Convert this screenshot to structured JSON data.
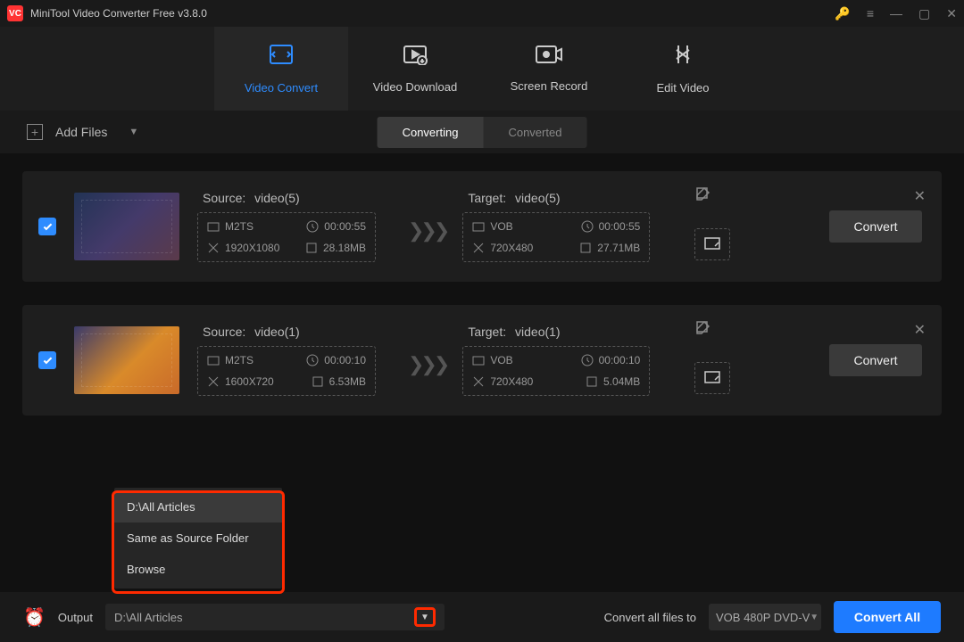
{
  "title": "MiniTool Video Converter Free v3.8.0",
  "nav": {
    "video_convert": "Video Convert",
    "video_download": "Video Download",
    "screen_record": "Screen Record",
    "edit_video": "Edit Video"
  },
  "toolbar": {
    "add_files": "Add Files",
    "converting": "Converting",
    "converted": "Converted"
  },
  "files": [
    {
      "source_label": "Source:",
      "source_name": "video(5)",
      "src_format": "M2TS",
      "src_duration": "00:00:55",
      "src_res": "1920X1080",
      "src_size": "28.18MB",
      "target_label": "Target:",
      "target_name": "video(5)",
      "tgt_format": "VOB",
      "tgt_duration": "00:00:55",
      "tgt_res": "720X480",
      "tgt_size": "27.71MB",
      "convert": "Convert"
    },
    {
      "source_label": "Source:",
      "source_name": "video(1)",
      "src_format": "M2TS",
      "src_duration": "00:00:10",
      "src_res": "1600X720",
      "src_size": "6.53MB",
      "target_label": "Target:",
      "target_name": "video(1)",
      "tgt_format": "VOB",
      "tgt_duration": "00:00:10",
      "tgt_res": "720X480",
      "tgt_size": "5.04MB",
      "convert": "Convert"
    }
  ],
  "output": {
    "label": "Output",
    "path": "D:\\All Articles",
    "menu": {
      "recent": "D:\\All Articles",
      "same": "Same as Source Folder",
      "browse": "Browse"
    }
  },
  "footer": {
    "convert_all_label": "Convert all files to",
    "format": "VOB 480P DVD-V",
    "convert_all": "Convert All"
  }
}
